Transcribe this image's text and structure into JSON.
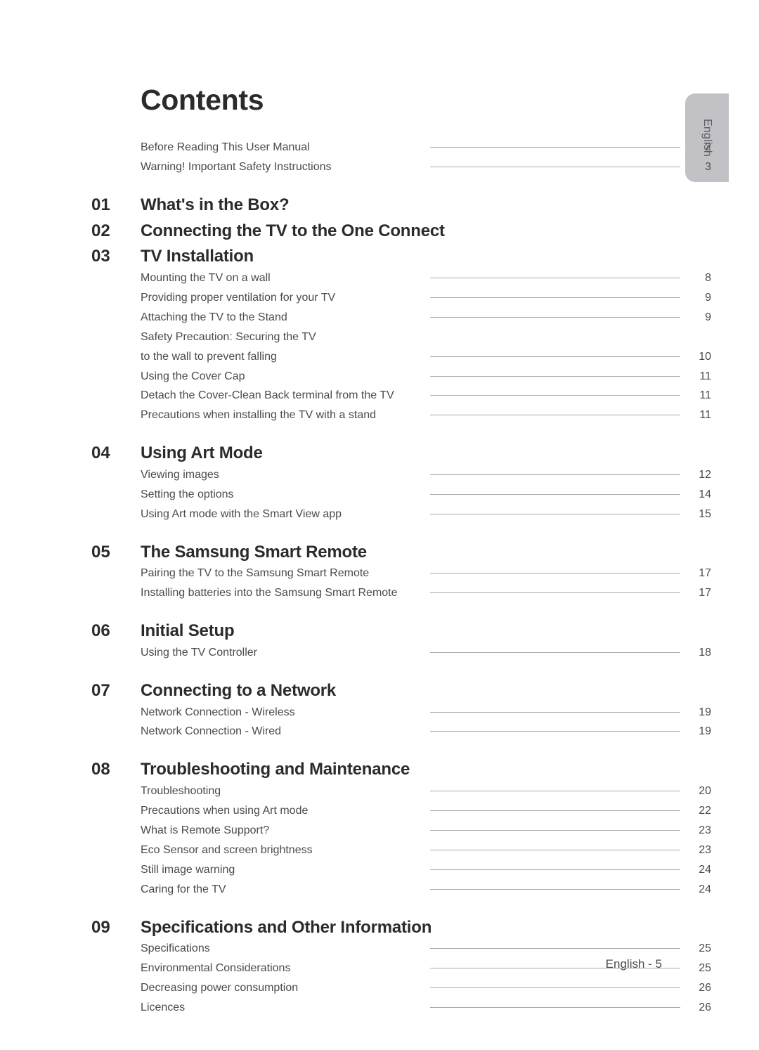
{
  "page": {
    "title": "Contents",
    "footer": "English - 5",
    "language_tab": "English"
  },
  "front_matter": [
    {
      "label": "Before Reading This User Manual",
      "page": "2",
      "leader": true
    },
    {
      "label": "Warning! Important Safety Instructions",
      "page": "3",
      "leader": true
    }
  ],
  "sections": [
    {
      "number": "01",
      "title": "What's in the Box?",
      "tight": false,
      "entries": []
    },
    {
      "number": "02",
      "title": "Connecting the TV to the One Connect",
      "tight": true,
      "entries": []
    },
    {
      "number": "03",
      "title": "TV Installation",
      "tight": true,
      "entries": [
        {
          "label": "Mounting the TV on a wall",
          "page": "8",
          "leader": true
        },
        {
          "label": "Providing proper ventilation for your TV",
          "page": "9",
          "leader": true
        },
        {
          "label": "Attaching the TV to the Stand",
          "page": "9",
          "leader": true
        },
        {
          "label": "Safety Precaution: Securing the TV",
          "page": "",
          "leader": false
        },
        {
          "label": "to the wall to prevent falling",
          "page": "10",
          "leader": true
        },
        {
          "label": "Using the Cover Cap",
          "page": "11",
          "leader": true
        },
        {
          "label": "Detach the Cover-Clean Back terminal from the TV",
          "page": "11",
          "leader": true
        },
        {
          "label": "Precautions when installing the TV with a stand",
          "page": "11",
          "leader": true
        }
      ]
    },
    {
      "number": "04",
      "title": "Using Art Mode",
      "tight": false,
      "entries": [
        {
          "label": "Viewing images",
          "page": "12",
          "leader": true
        },
        {
          "label": "Setting the options",
          "page": "14",
          "leader": true
        },
        {
          "label": "Using Art mode with the Smart View app",
          "page": "15",
          "leader": true
        }
      ]
    },
    {
      "number": "05",
      "title": "The Samsung Smart Remote",
      "tight": false,
      "entries": [
        {
          "label": "Pairing the TV to the Samsung Smart Remote",
          "page": "17",
          "leader": true
        },
        {
          "label": "Installing batteries into the Samsung Smart Remote",
          "page": "17",
          "leader": true
        }
      ]
    },
    {
      "number": "06",
      "title": "Initial Setup",
      "tight": false,
      "entries": [
        {
          "label": "Using the TV Controller",
          "page": "18",
          "leader": true
        }
      ]
    },
    {
      "number": "07",
      "title": "Connecting to a Network",
      "tight": false,
      "entries": [
        {
          "label": "Network Connection - Wireless",
          "page": "19",
          "leader": true
        },
        {
          "label": "Network Connection - Wired",
          "page": "19",
          "leader": true
        }
      ]
    },
    {
      "number": "08",
      "title": "Troubleshooting and Maintenance",
      "tight": false,
      "entries": [
        {
          "label": "Troubleshooting",
          "page": "20",
          "leader": true
        },
        {
          "label": "Precautions when using Art mode",
          "page": "22",
          "leader": true
        },
        {
          "label": "What is Remote Support?",
          "page": "23",
          "leader": true
        },
        {
          "label": "Eco Sensor and screen brightness",
          "page": "23",
          "leader": true
        },
        {
          "label": "Still image warning",
          "page": "24",
          "leader": true
        },
        {
          "label": "Caring for the TV",
          "page": "24",
          "leader": true
        }
      ]
    },
    {
      "number": "09",
      "title": "Specifications and Other Information",
      "tight": false,
      "entries": [
        {
          "label": "Specifications",
          "page": "25",
          "leader": true
        },
        {
          "label": "Environmental Considerations",
          "page": "25",
          "leader": true
        },
        {
          "label": "Decreasing power consumption",
          "page": "26",
          "leader": true
        },
        {
          "label": "Licences",
          "page": "26",
          "leader": true
        }
      ]
    }
  ],
  "colors": {
    "heading": "#2c2a2b",
    "body": "#4b4a4d",
    "leader": "#a9a9ae",
    "tab": "#c2c2c6"
  }
}
